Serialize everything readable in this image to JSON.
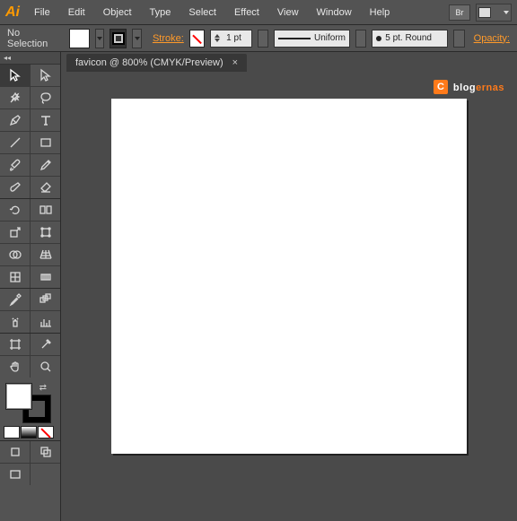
{
  "app": {
    "logo_text": "Ai"
  },
  "menu": [
    "File",
    "Edit",
    "Object",
    "Type",
    "Select",
    "Effect",
    "View",
    "Window",
    "Help"
  ],
  "menubar_right": {
    "br_badge": "Br"
  },
  "controlbar": {
    "selection": "No Selection",
    "stroke_label": "Stroke:",
    "stroke_weight": "1 pt",
    "stroke_profile": "Uniform",
    "brush": "5 pt. Round",
    "opacity_label": "Opacity:"
  },
  "document_tab": {
    "title": "favicon @ 800% (CMYK/Preview)",
    "close": "×"
  },
  "watermark": {
    "icon_letter": "C",
    "text1": "blog",
    "text2": "ernas"
  },
  "toolpanel_collapse": "◂◂"
}
